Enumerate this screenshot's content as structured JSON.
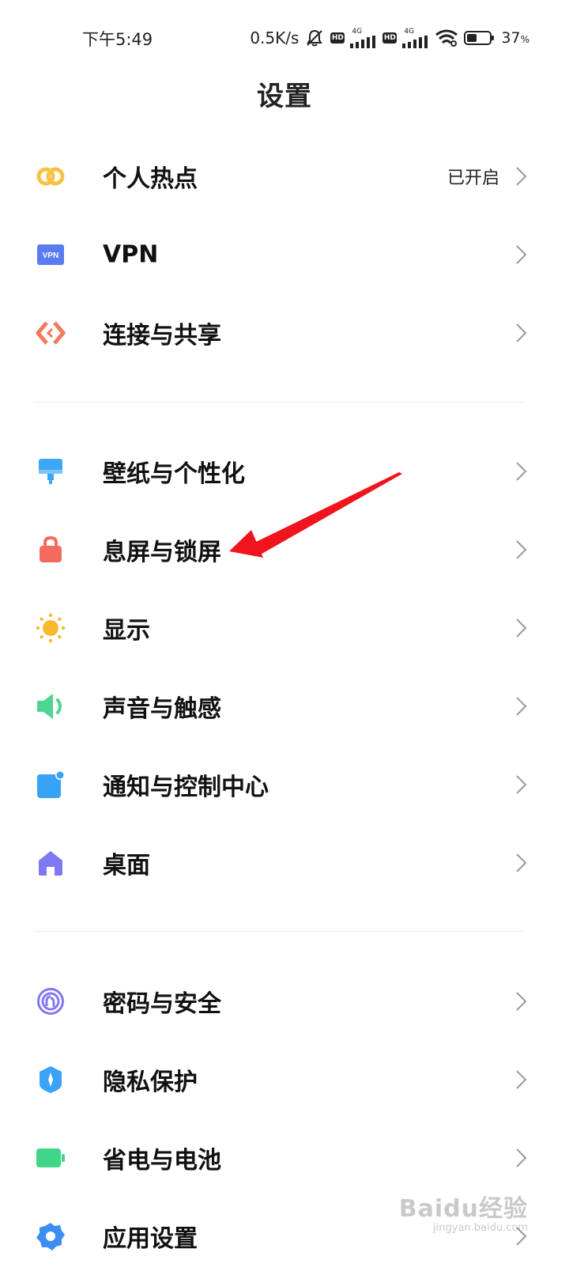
{
  "status_bar": {
    "time": "下午5:49",
    "net_speed": "0.5K/s",
    "hd1": "HD",
    "sig1_type": "4G",
    "hd2": "HD",
    "sig2_type": "4G",
    "battery_percent": "37",
    "battery_unit": "%"
  },
  "page": {
    "title": "设置"
  },
  "items": {
    "hotspot": {
      "label": "个人热点",
      "value": "已开启",
      "icon": "hotspot-icon"
    },
    "vpn": {
      "label": "VPN",
      "icon": "vpn-icon"
    },
    "connection": {
      "label": "连接与共享",
      "icon": "connection-icon"
    },
    "wallpaper": {
      "label": "壁纸与个性化",
      "icon": "wallpaper-icon"
    },
    "lockscreen": {
      "label": "息屏与锁屏",
      "icon": "lock-icon"
    },
    "display": {
      "label": "显示",
      "icon": "sun-icon"
    },
    "sound": {
      "label": "声音与触感",
      "icon": "speaker-icon"
    },
    "notification": {
      "label": "通知与控制中心",
      "icon": "notification-icon"
    },
    "desktop": {
      "label": "桌面",
      "icon": "home-icon"
    },
    "password": {
      "label": "密码与安全",
      "icon": "fingerprint-icon"
    },
    "privacy": {
      "label": "隐私保护",
      "icon": "privacy-shield-icon"
    },
    "battery": {
      "label": "省电与电池",
      "icon": "battery-icon"
    },
    "apps": {
      "label": "应用设置",
      "icon": "gear-icon"
    }
  },
  "watermark": {
    "brand": "Baidu经验",
    "url": "jingyan.baidu.com"
  },
  "colors": {
    "hotspot": "#F6C244",
    "vpn": "#5B7CF0",
    "connection": "#F07A5A",
    "wallpaper": "#3DA7F6",
    "lock": "#F36B5F",
    "sun": "#F9B92F",
    "sound": "#4ED58E",
    "notification": "#37A3F7",
    "desktop": "#7F78F2",
    "password": "#8477EF",
    "privacy": "#3BA2F5",
    "battery": "#3FD68A",
    "apps": "#3C8EF3",
    "annotation_arrow": "#F0141C"
  }
}
